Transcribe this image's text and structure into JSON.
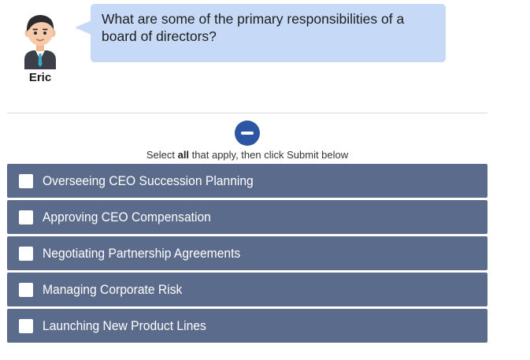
{
  "speaker": {
    "name": "Eric",
    "question": "What are some of the primary responsibilities of a board of directors?"
  },
  "instruction": {
    "prefix": "Select ",
    "emphasis": "all",
    "suffix": " that apply, then click Submit below"
  },
  "options": [
    {
      "label": "Overseeing CEO Succession Planning",
      "checked": false
    },
    {
      "label": "Approving CEO Compensation",
      "checked": false
    },
    {
      "label": "Negotiating Partnership Agreements",
      "checked": false
    },
    {
      "label": "Managing Corporate Risk",
      "checked": false
    },
    {
      "label": "Launching New Product Lines",
      "checked": false
    }
  ],
  "colors": {
    "bubble": "#c6d9f7",
    "option_background": "#5b6b8b",
    "collapse_button": "#2c55a3"
  },
  "icons": {
    "collapse": "minus-circle-icon",
    "avatar": "cartoon-man-avatar"
  }
}
